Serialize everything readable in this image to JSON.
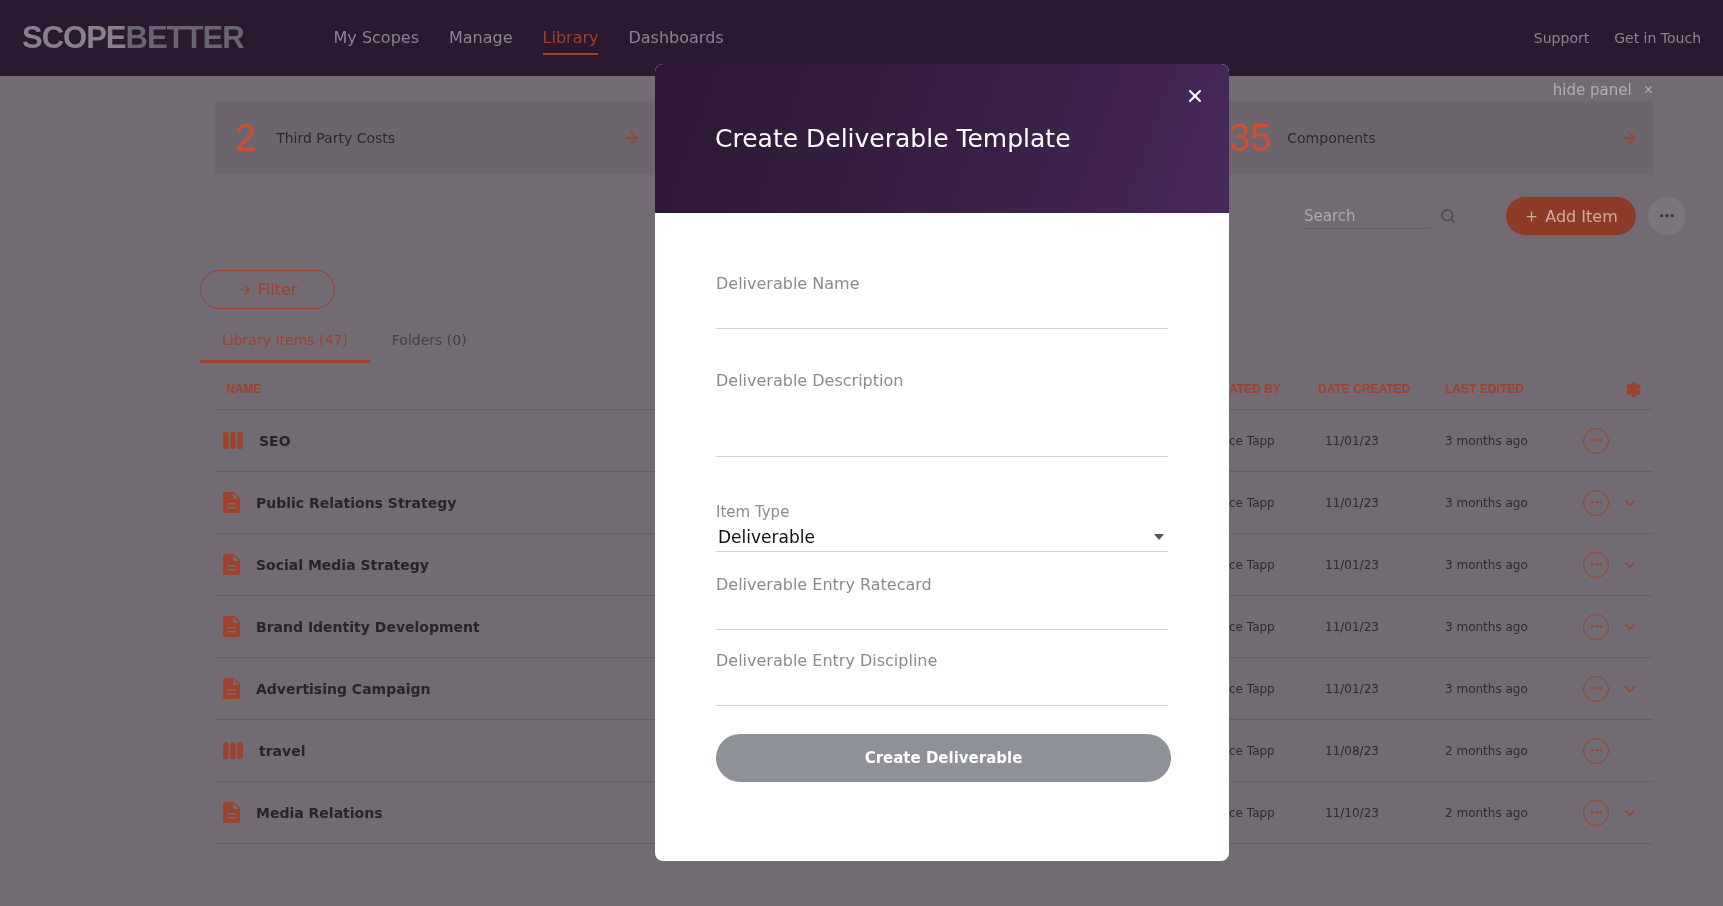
{
  "nav": {
    "logo": [
      "SCOPE",
      "BETTER"
    ],
    "links": [
      {
        "label": "My Scopes",
        "selected": false
      },
      {
        "label": "Manage",
        "selected": false
      },
      {
        "label": "Library",
        "selected": true
      },
      {
        "label": "Dashboards",
        "selected": false
      }
    ],
    "right_links": [
      "Support",
      "Get in Touch"
    ]
  },
  "panel": {
    "hide_label": "hide panel",
    "close": "×",
    "cards": [
      {
        "count": "2",
        "label": "Third Party Costs"
      },
      {
        "count": "35",
        "label": "Components"
      }
    ]
  },
  "toolbar": {
    "filter": "Filter",
    "search": {
      "placeholder": "Search"
    },
    "add_button": "Add Item"
  },
  "tabs": [
    {
      "label": "Library Items (47)",
      "selected": true
    },
    {
      "label": "Folders (0)",
      "selected": false
    }
  ],
  "table": {
    "left_columns": [
      "NAME"
    ],
    "right_columns": [
      "ATED BY",
      "DATE CREATED",
      "LAST EDITED"
    ],
    "rows": [
      {
        "kind": "group",
        "name": "SEO",
        "created_by": "ce Tapp",
        "date_created": "11/01/23",
        "last_edited": "3 months ago",
        "expandable": false
      },
      {
        "kind": "document",
        "name": "Public Relations Strategy",
        "created_by": "ce Tapp",
        "date_created": "11/01/23",
        "last_edited": "3 months ago",
        "expandable": true
      },
      {
        "kind": "document",
        "name": "Social Media Strategy",
        "created_by": "ce Tapp",
        "date_created": "11/01/23",
        "last_edited": "3 months ago",
        "expandable": true
      },
      {
        "kind": "document",
        "name": "Brand Identity Development",
        "created_by": "ce Tapp",
        "date_created": "11/01/23",
        "last_edited": "3 months ago",
        "expandable": true
      },
      {
        "kind": "document",
        "name": "Advertising Campaign",
        "created_by": "ce Tapp",
        "date_created": "11/01/23",
        "last_edited": "3 months ago",
        "expandable": true
      },
      {
        "kind": "group",
        "name": "travel",
        "created_by": "ce Tapp",
        "date_created": "11/08/23",
        "last_edited": "2 months ago",
        "expandable": false
      },
      {
        "kind": "document",
        "name": "Media Relations",
        "created_by": "ce Tapp",
        "date_created": "11/10/23",
        "last_edited": "2 months ago",
        "expandable": true
      }
    ]
  },
  "modal": {
    "title": "Create Deliverable Template",
    "fields": [
      {
        "kind": "text",
        "placeholder": "Deliverable Name"
      },
      {
        "kind": "textarea",
        "placeholder": "Deliverable Description"
      },
      {
        "kind": "select",
        "label": "Item Type",
        "value": "Deliverable"
      },
      {
        "kind": "text",
        "placeholder": "Deliverable Entry Ratecard"
      },
      {
        "kind": "text",
        "placeholder": "Deliverable Entry Discipline"
      }
    ],
    "submit": {
      "label": "Create Deliverable",
      "disabled": true
    }
  }
}
